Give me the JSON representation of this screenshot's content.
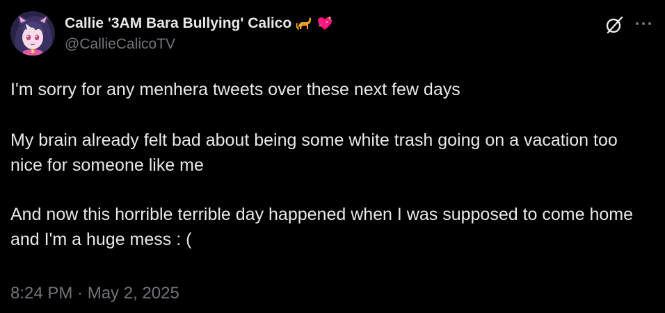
{
  "author": {
    "display_name": "Callie '3AM Bara Bullying' Calico",
    "handle": "@CallieCalicoTV",
    "avatar_icon": "anime-avatar",
    "name_emojis": [
      "cat-emoji",
      "sparkling-heart-emoji"
    ]
  },
  "header_actions": {
    "grok_icon": "grok-icon",
    "more_icon": "more-icon"
  },
  "tweet": {
    "paragraphs": [
      "I'm sorry for any menhera tweets over these next few days",
      "My brain already felt bad about being some white trash going on a vacation too nice for someone like me",
      "And now this horrible terrible day happened when I was supposed to come home and I'm a huge mess : ("
    ],
    "timestamp": "8:24 PM · May 2, 2025"
  },
  "colors": {
    "background": "#000000",
    "primary_text": "#e7e9ea",
    "secondary_text": "#71767b",
    "heart": "#f91880",
    "cat": "#f4a828"
  }
}
